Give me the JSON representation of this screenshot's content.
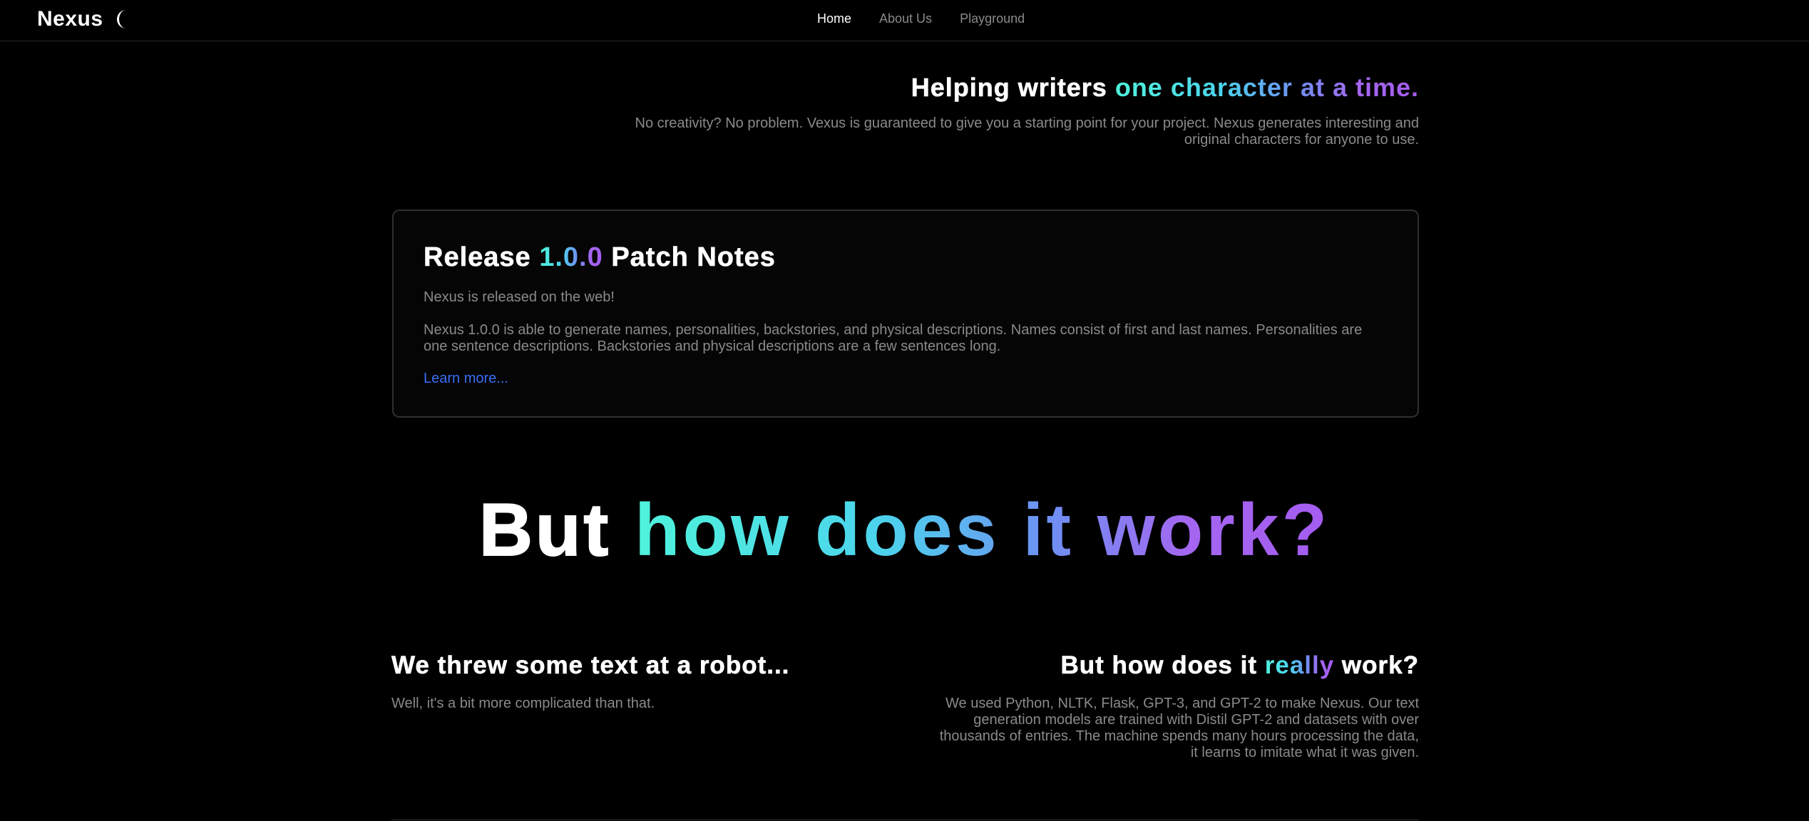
{
  "navbar": {
    "brand": "Nexus",
    "theme_icon": "crescent-moon-icon",
    "links": [
      {
        "label": "Home",
        "active": true
      },
      {
        "label": "About Us",
        "active": false
      },
      {
        "label": "Playground",
        "active": false
      }
    ]
  },
  "hero": {
    "title_plain": "Helping writers ",
    "title_gradient": "one character at a time.",
    "subtitle": "No creativity? No problem. Vexus is guaranteed to give you a starting point for your project. Nexus generates interesting and original characters for anyone to use."
  },
  "release": {
    "title_prefix": "Release ",
    "version": "1.0.0",
    "title_suffix": " Patch Notes",
    "paragraph1": "Nexus is released on the web!",
    "paragraph2": "Nexus 1.0.0 is able to generate names, personalities, backstories, and physical descriptions. Names consist of first and last names. Personalities are one sentence descriptions. Backstories and physical descriptions are a few sentences long.",
    "link": "Learn more..."
  },
  "how": {
    "plain": "But ",
    "gradient": "how does it work?"
  },
  "left_col": {
    "title": "We threw some text at a robot...",
    "text": "Well, it's a bit more complicated than that."
  },
  "right_col": {
    "title_prefix": "But how does it ",
    "title_highlight": "really",
    "title_suffix": " work?",
    "text": "We used Python, NLTK, Flask, GPT-3, and GPT-2 to make Nexus. Our text generation models are trained with Distil GPT-2 and datasets with over thousands of entries. The machine spends many hours processing the data, it learns to imitate what it was given."
  },
  "colors": {
    "background": "#000000",
    "muted_text": "#8a8a8a",
    "link": "#3b6ef8",
    "gradient_start": "#4ff3dc",
    "gradient_end": "#a45cf0"
  }
}
